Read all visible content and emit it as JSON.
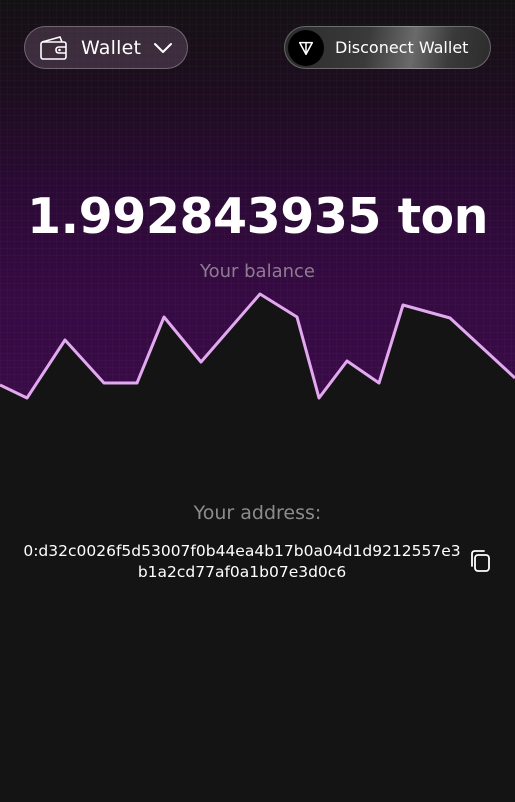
{
  "header": {
    "wallet_button_label": "Wallet",
    "wallet_icon": "wallet-icon",
    "chevron_icon": "chevron-down-icon",
    "disconnect_button_label": "Disconect Wallet",
    "ton_icon": "ton-logo-icon"
  },
  "balance": {
    "value": "1.992843935 ton",
    "caption": "Your balance"
  },
  "address": {
    "caption": "Your address:",
    "value": "0:d32c0026f5d53007f0b44ea4b17b0a04d1d9212557e3b1a2cd77af0a1b07e3d0c6",
    "copy_icon": "copy-icon"
  },
  "colors": {
    "background": "#141414",
    "gradient_top": "#1d0d1f",
    "gradient_bottom": "#3a0b48",
    "chart_line": "#e3a9f0",
    "caption_purple": "#8e7d92",
    "caption_gray": "#8c8c8c"
  }
}
